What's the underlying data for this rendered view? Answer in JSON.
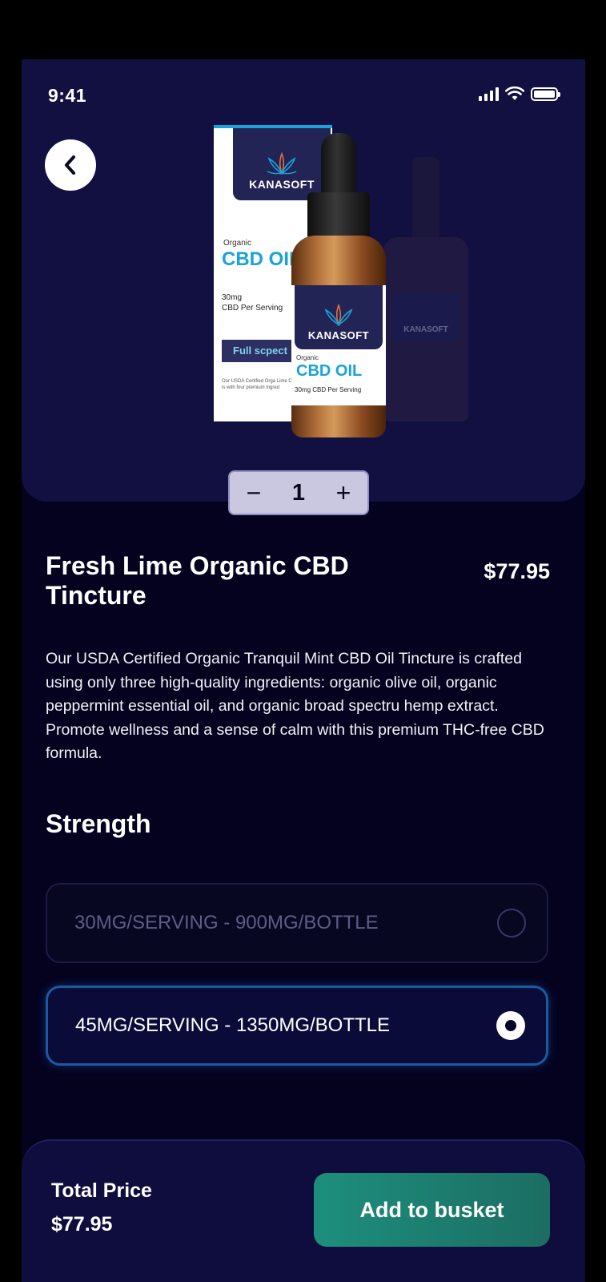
{
  "status_bar": {
    "time": "9:41"
  },
  "product_image": {
    "box_brand": "KANASOFT",
    "box_organic": "Organic",
    "box_cbd": "CBD OIL",
    "box_mg_line1": "30mg",
    "box_mg_line2": "CBD Per Serving",
    "box_band": "Full scpect",
    "box_small": "Our USDA Certified Orga Lime CBD Oil Tincture is with four premium ingred",
    "bottle_brand": "KANASOFT",
    "bottle_organic": "Organic",
    "bottle_cbd": "CBD OIL",
    "bottle_mg": "30mg CBD Per Serving",
    "ghost_brand": "KANASOFT"
  },
  "stepper": {
    "minus": "−",
    "quantity": "1",
    "plus": "+"
  },
  "product": {
    "title": "Fresh Lime Organic CBD Tincture",
    "price": "$77.95",
    "description": "Our USDA Certified Organic Tranquil Mint CBD Oil Tincture is crafted using only three high-quality ingredients: organic olive oil, organic peppermint essential oil, and organic broad spectru hemp extract. Promote wellness and a sense of calm with this premium THC-free CBD formula."
  },
  "strength": {
    "heading": "Strength",
    "options": [
      {
        "label": "30MG/SERVING - 900MG/BOTTLE",
        "selected": false
      },
      {
        "label": "45MG/SERVING - 1350MG/BOTTLE",
        "selected": true
      }
    ]
  },
  "footer": {
    "total_label": "Total Price",
    "total_value": "$77.95",
    "add_button": "Add to busket"
  },
  "colors": {
    "background": "#04021f",
    "hero": "#121040",
    "accent_button": "#1d8f7d",
    "selected_border": "#1a5aa0"
  }
}
